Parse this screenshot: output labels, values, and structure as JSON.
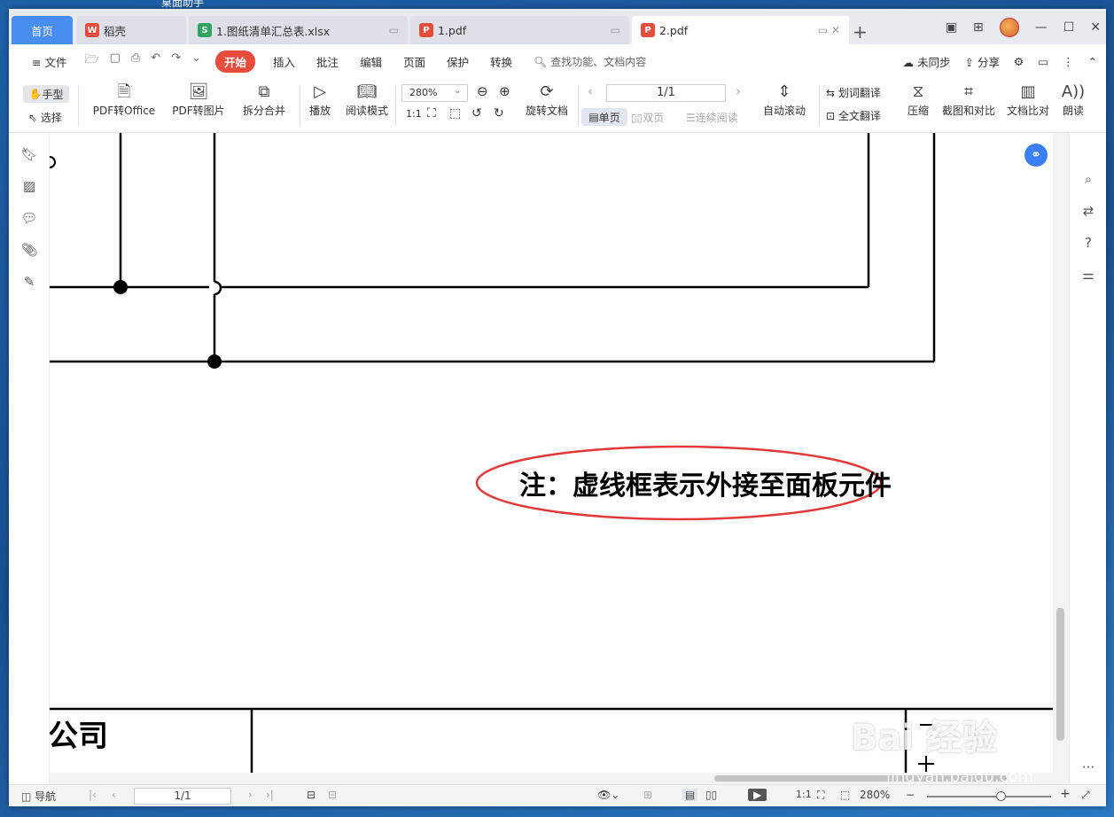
{
  "desktop": {
    "title": "桌面助手"
  },
  "tabs": [
    {
      "label": "首页"
    },
    {
      "label": "稻壳"
    },
    {
      "label": "1.图纸清单汇总表.xlsx"
    },
    {
      "label": "1.pdf"
    },
    {
      "label": "2.pdf"
    }
  ],
  "menu": {
    "file": "文件",
    "items": [
      "开始",
      "插入",
      "批注",
      "编辑",
      "页面",
      "保护",
      "转换"
    ],
    "search_placeholder": "查找功能、文档内容",
    "sync": "未同步",
    "share": "分享"
  },
  "toolbar": {
    "hand": "手型",
    "select": "选择",
    "pdf_to_office": "PDF转Office",
    "pdf_to_image": "PDF转图片",
    "split_merge": "拆分合并",
    "play": "播放",
    "read_mode": "阅读模式",
    "zoom": "280%",
    "page": "1/1",
    "rotate_doc": "旋转文档",
    "single_page": "单页",
    "double_page": "双页",
    "continuous": "连续阅读",
    "auto_scroll": "自动滚动",
    "word_translate": "划词翻译",
    "full_translate": "全文翻译",
    "compress": "压缩",
    "screenshot_compare": "截图和对比",
    "doc_compare": "文档比对",
    "read_aloud": "朗读"
  },
  "document": {
    "note": "注：虚线框表示外接至面板元件",
    "company_fragment": "公司"
  },
  "statusbar": {
    "nav": "导航",
    "page": "1/1",
    "zoom": "280%"
  },
  "watermark": {
    "main": "Bai 经验",
    "sub": "jingyan.baidu.com"
  },
  "colors": {
    "accent": "#4a8df0",
    "active_menu": "#e84c3d",
    "annotation_ellipse": "#e03a3a"
  }
}
